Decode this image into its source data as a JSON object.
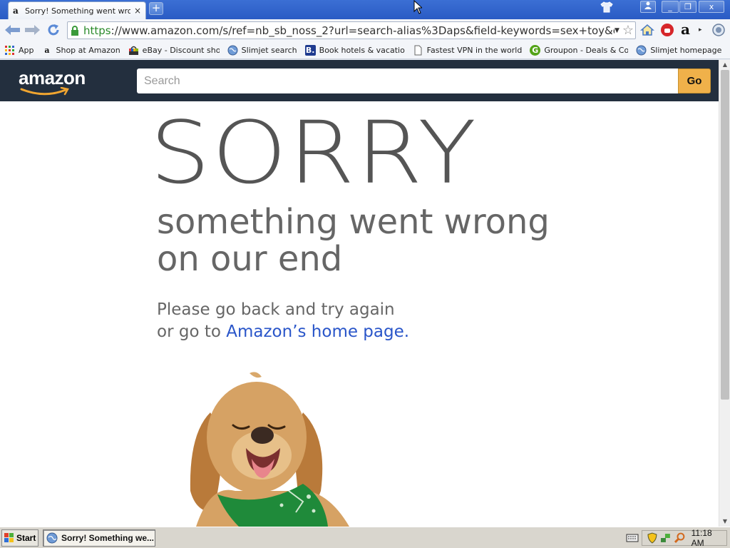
{
  "browser": {
    "tab_title": "Sorry! Something went wron",
    "tab_close": "×",
    "new_tab": "+",
    "url_protocol": "https",
    "url_rest": "://www.amazon.com/s/ref=nb_sb_noss_2?url=search-alias%3Daps&field-keywords=sex+toy&crid",
    "window_buttons": [
      "_",
      "❐",
      "x"
    ]
  },
  "bookmarks": [
    {
      "label": "App",
      "icon": "apps-grid-icon"
    },
    {
      "label": "Shop at Amazon",
      "icon": "amazon-icon"
    },
    {
      "label": "eBay - Discount shoppin",
      "icon": "ebay-icon"
    },
    {
      "label": "Slimjet search",
      "icon": "globe-icon"
    },
    {
      "label": "Book hotels & vacation r",
      "icon": "booking-icon"
    },
    {
      "label": "Fastest VPN in the world",
      "icon": "page-icon"
    },
    {
      "label": "Groupon - Deals & Coup",
      "icon": "groupon-icon"
    },
    {
      "label": "Slimjet homepage",
      "icon": "globe-icon"
    }
  ],
  "amazon": {
    "logo_text": "amazon",
    "search_placeholder": "Search",
    "go_label": "Go",
    "headline": "SORRY",
    "subline1": "something went wrong",
    "subline2": "on our end",
    "message1": "Please go back and try again",
    "message2_prefix": "or go to ",
    "message2_link": "Amazon’s home page."
  },
  "taskbar": {
    "start_label": "Start",
    "task_item": "Sorry! Something we...",
    "clock": "11:18 AM"
  },
  "colors": {
    "amazon_header": "#232f3e",
    "go_button": "#f0b14a",
    "link": "#2955c9"
  }
}
